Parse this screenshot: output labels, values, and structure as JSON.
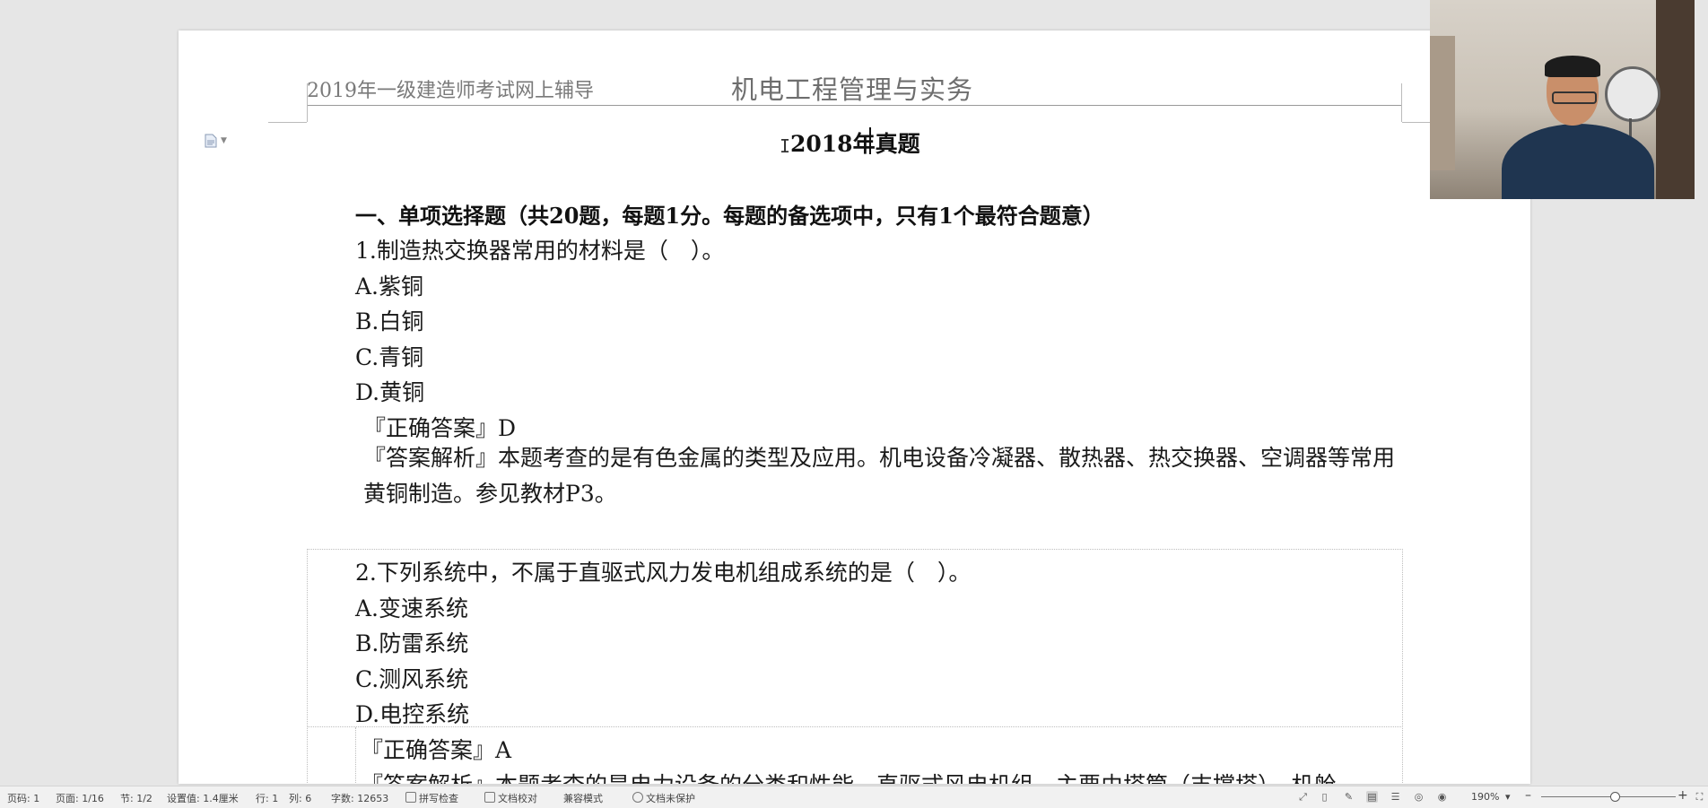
{
  "header": {
    "left_text": "2019年一级建造师考试网上辅导",
    "center_text": "机电工程管理与实务"
  },
  "document": {
    "title": "2018年真题",
    "section_heading": "一、单项选择题（共20题，每题1分。每题的备选项中，只有1个最符合题意）",
    "q1": {
      "stem": "1.制造热交换器常用的材料是（　）。",
      "options": [
        "A.紫铜",
        "B.白铜",
        "C.青铜",
        "D.黄铜"
      ],
      "answer": "『正确答案』D",
      "analysis": "『答案解析』本题考查的是有色金属的类型及应用。机电设备冷凝器、散热器、热交换器、空调器等常用黄铜制造。参见教材P3。"
    },
    "q2": {
      "stem": "2.下列系统中，不属于直驱式风力发电机组成系统的是（　）。",
      "options": [
        "A.变速系统",
        "B.防雷系统",
        "C.测风系统",
        "D.电控系统"
      ],
      "answer": "『正确答案』A",
      "analysis": "『答案解析』本题考查的是电力设备的分类和性能。直驱式风电机组，主要由塔筒（支撑塔）、机舱"
    }
  },
  "statusbar": {
    "page_code": "页码: 1",
    "page": "页面: 1/16",
    "section": "节: 1/2",
    "setting": "设置值: 1.4厘米",
    "row": "行: 1",
    "col": "列: 6",
    "wordcount": "字数: 12653",
    "spellcheck": "拼写检查",
    "proofread": "文档校对",
    "compat": "兼容模式",
    "protect": "文档未保护",
    "zoom": "190%",
    "zoom_out": "–",
    "zoom_in": "+"
  },
  "icons": [
    "doc-icon",
    "fullscreen-icon",
    "read-mode-icon",
    "edit-icon",
    "page-view-icon",
    "outline-view-icon",
    "web-view-icon",
    "eye-protect-icon",
    "fit-icon"
  ]
}
